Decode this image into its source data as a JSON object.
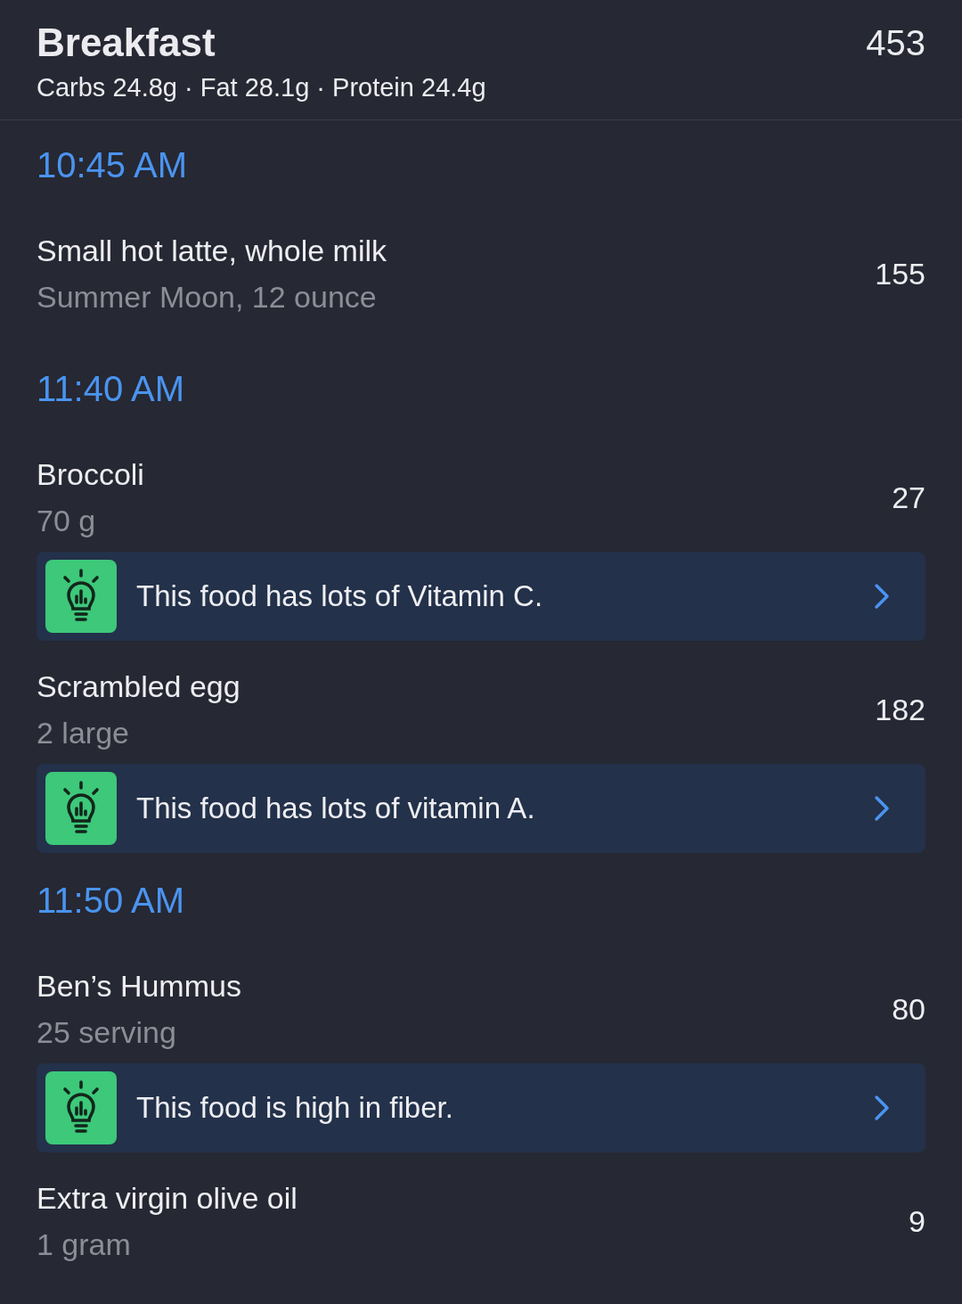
{
  "meal": {
    "title": "Breakfast",
    "calories": "453",
    "macros": "Carbs 24.8g · Fat 28.1g · Protein 24.4g"
  },
  "sections": [
    {
      "time": "10:45 AM",
      "foods": [
        {
          "name": "Small hot latte, whole milk",
          "serving": "Summer Moon, 12 ounce",
          "calories": "155"
        }
      ]
    },
    {
      "time": "11:40 AM",
      "foods": [
        {
          "name": "Broccoli",
          "serving": "70 g",
          "calories": "27",
          "tip": {
            "text": "This food has lots of Vitamin C."
          }
        },
        {
          "name": "Scrambled egg",
          "serving": "2 large",
          "calories": "182",
          "tip": {
            "text": "This food has lots of vitamin A."
          }
        }
      ]
    },
    {
      "time": "11:50 AM",
      "foods": [
        {
          "name": "Ben’s Hummus",
          "serving": "25 serving",
          "calories": "80",
          "tip": {
            "text": "This food is high in fiber."
          }
        },
        {
          "name": "Extra virgin olive oil",
          "serving": "1 gram",
          "calories": "9"
        }
      ]
    }
  ]
}
